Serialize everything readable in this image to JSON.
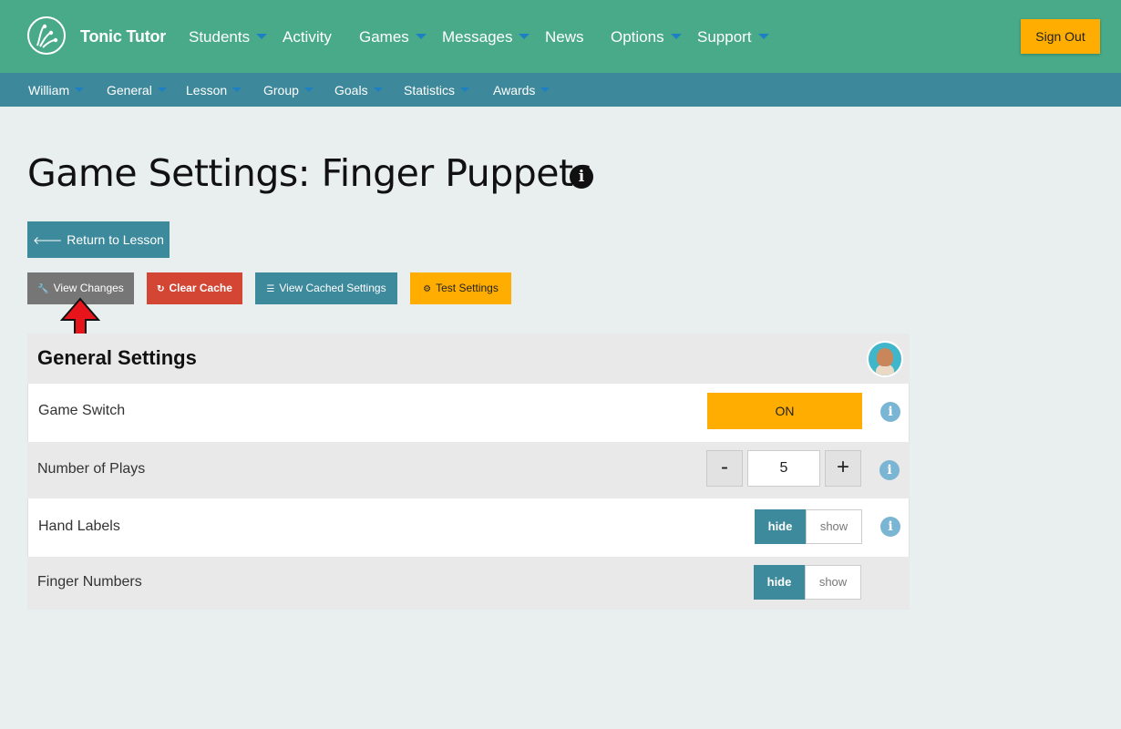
{
  "app": {
    "brand": "Tonic Tutor"
  },
  "topnav": {
    "items": [
      {
        "label": "Students",
        "has_caret": true
      },
      {
        "label": "Activity",
        "has_caret": false
      },
      {
        "label": "Games",
        "has_caret": true
      },
      {
        "label": "Messages",
        "has_caret": true
      },
      {
        "label": "News",
        "has_caret": false
      },
      {
        "label": "Options",
        "has_caret": true
      },
      {
        "label": "Support",
        "has_caret": true
      }
    ],
    "sign_out": "Sign Out"
  },
  "subnav": {
    "items": [
      "William",
      "General",
      "Lesson",
      "Group",
      "Goals",
      "Statistics",
      "Awards"
    ]
  },
  "page": {
    "title": "Game Settings: Finger Puppets",
    "return_button": "Return to Lesson",
    "actions": {
      "view_changes": "View Changes",
      "clear_cache": "Clear Cache",
      "view_cached": "View Cached Settings",
      "test_settings": "Test Settings"
    }
  },
  "panel": {
    "title": "General Settings",
    "rows": {
      "game_switch": {
        "label": "Game Switch",
        "value": "ON"
      },
      "plays": {
        "label": "Number of Plays",
        "value": "5",
        "minus": "-",
        "plus": "+"
      },
      "hand_labels": {
        "label": "Hand Labels",
        "hide": "hide",
        "show": "show",
        "selected": "hide"
      },
      "finger_numbers": {
        "label": "Finger Numbers",
        "hide": "hide",
        "show": "show",
        "selected": "hide"
      }
    }
  },
  "colors": {
    "topnav": "#48aa89",
    "subnav": "#3d889a",
    "accent_orange": "#ffad00",
    "danger": "#d44634",
    "teal_button": "#3d8a9c",
    "grey_button": "#767676",
    "annotation_arrow": "#e8141c"
  }
}
